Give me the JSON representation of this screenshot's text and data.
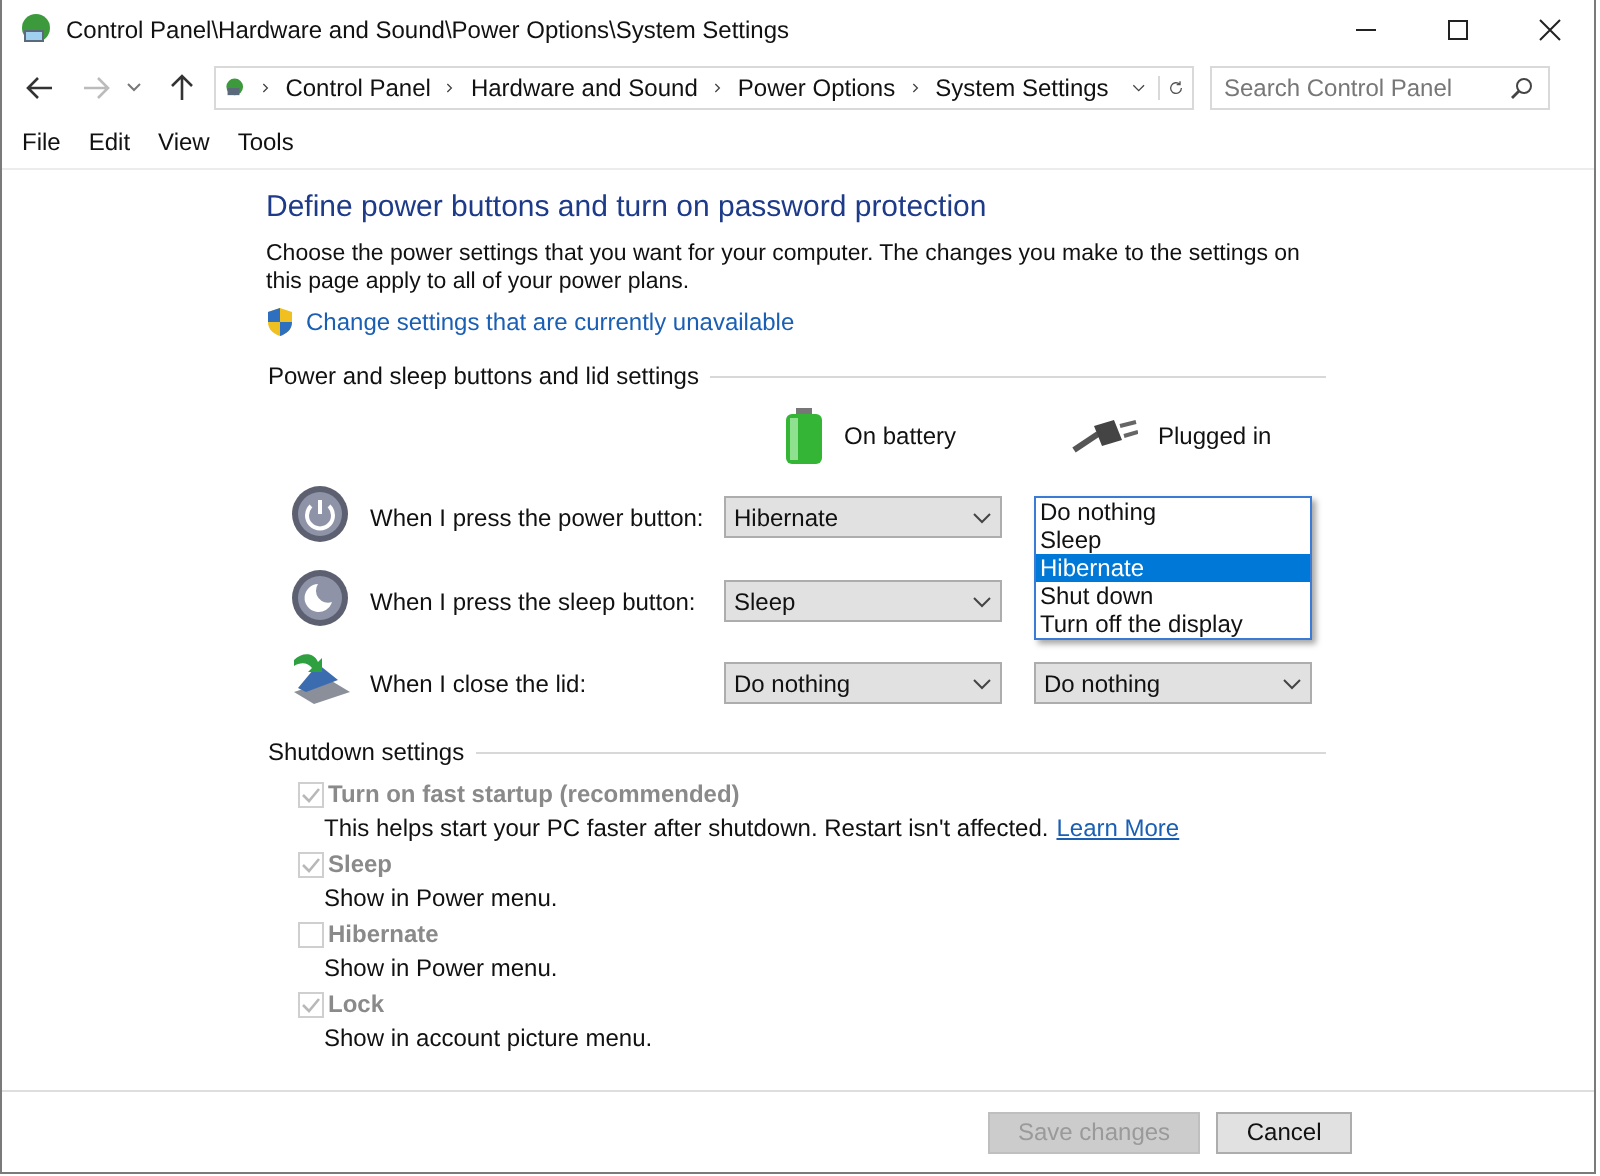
{
  "window": {
    "title": "Control Panel\\Hardware and Sound\\Power Options\\System Settings"
  },
  "address_bar": {
    "crumbs": [
      "Control Panel",
      "Hardware and Sound",
      "Power Options",
      "System Settings"
    ]
  },
  "search": {
    "placeholder": "Search Control Panel"
  },
  "menu": [
    "File",
    "Edit",
    "View",
    "Tools"
  ],
  "heading": "Define power buttons and turn on password protection",
  "intro": "Choose the power settings that you want for your computer. The changes you make to the settings on this page apply to all of your power plans.",
  "admin_link": "Change settings that are currently unavailable",
  "power_section": {
    "title": "Power and sleep buttons and lid settings",
    "columns": [
      "On battery",
      "Plugged in"
    ],
    "rows": [
      {
        "kind": "power",
        "label": "When I press the power button:",
        "on_battery": "Hibernate",
        "open_list": [
          {
            "label": "Do nothing",
            "selected": false
          },
          {
            "label": "Sleep",
            "selected": false
          },
          {
            "label": "Hibernate",
            "selected": true
          },
          {
            "label": "Shut down",
            "selected": false
          },
          {
            "label": "Turn off the display",
            "selected": false
          }
        ]
      },
      {
        "kind": "sleep",
        "label": "When I press the sleep button:",
        "on_battery": "Sleep"
      },
      {
        "kind": "lid",
        "label": "When I close the lid:",
        "on_battery": "Do nothing",
        "plugged_in": "Do nothing"
      }
    ]
  },
  "shutdown_section": {
    "title": "Shutdown settings",
    "items": [
      {
        "label": "Turn on fast startup (recommended)",
        "checked": true,
        "disabled": true,
        "description": "This helps start your PC faster after shutdown. Restart isn't affected.",
        "link": "Learn More"
      },
      {
        "label": "Sleep",
        "checked": true,
        "disabled": true,
        "description": "Show in Power menu."
      },
      {
        "label": "Hibernate",
        "checked": false,
        "disabled": true,
        "description": "Show in Power menu."
      },
      {
        "label": "Lock",
        "checked": true,
        "disabled": true,
        "description": "Show in account picture menu."
      }
    ]
  },
  "buttons": [
    {
      "label": "Save changes",
      "disabled": true
    },
    {
      "label": "Cancel",
      "disabled": false
    }
  ]
}
